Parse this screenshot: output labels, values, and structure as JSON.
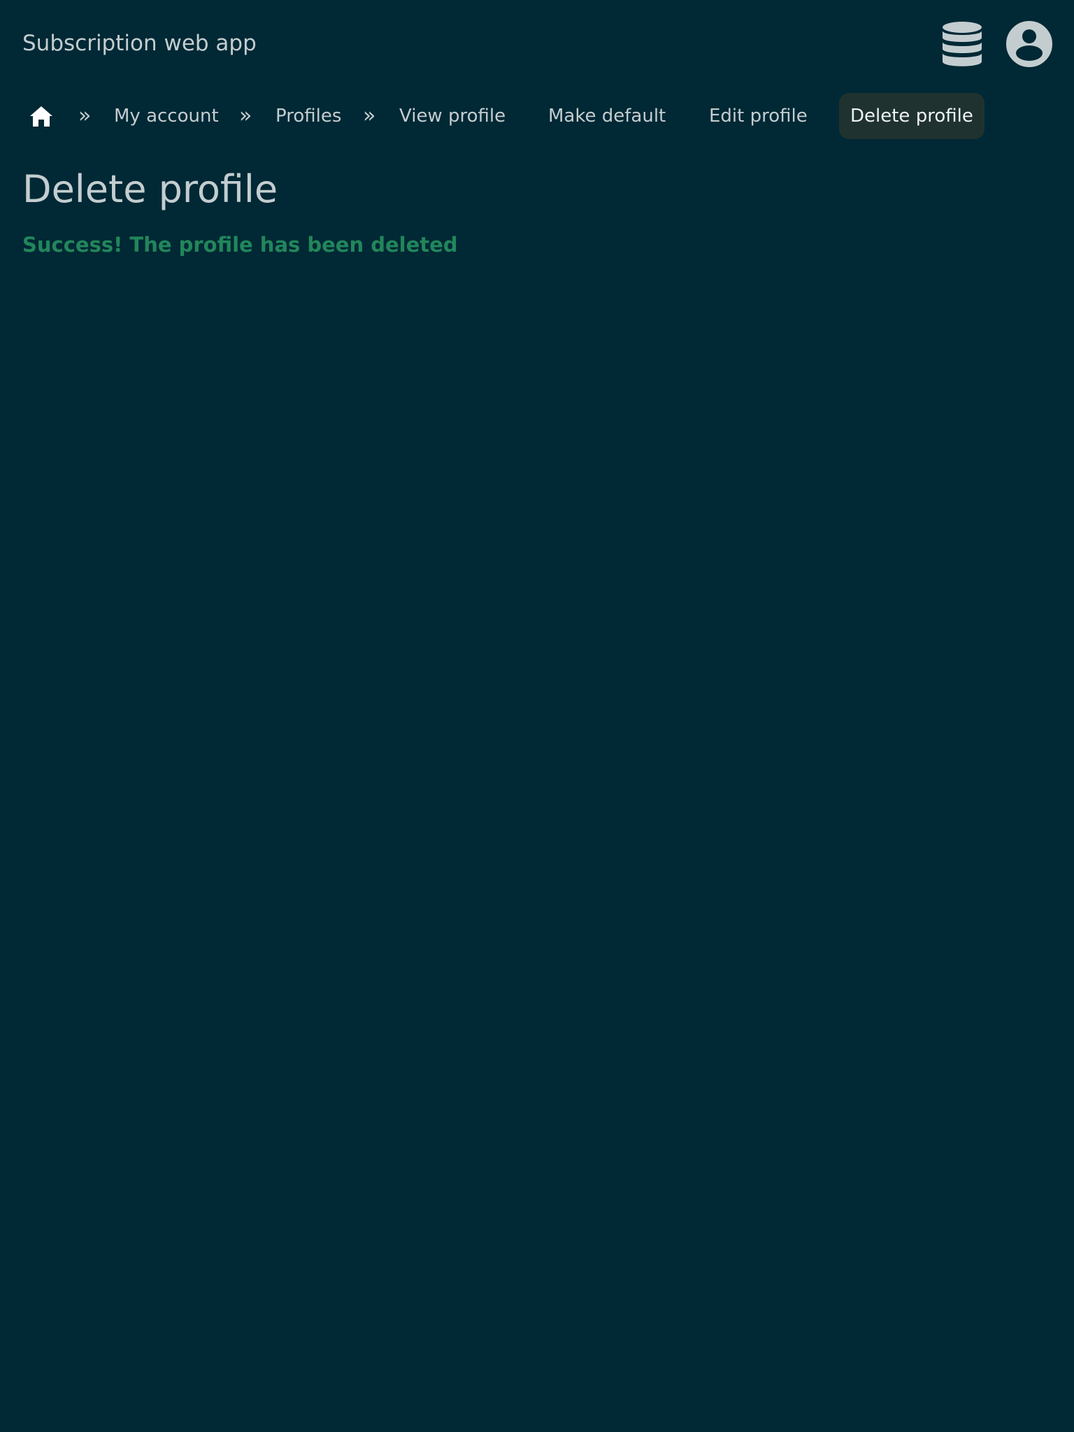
{
  "header": {
    "app_title": "Subscription web app",
    "icons": [
      "database-icon",
      "user-circle-icon"
    ]
  },
  "breadcrumb": {
    "home_icon": "home-icon",
    "separator": "»",
    "items": [
      {
        "label": "My account"
      },
      {
        "label": "Profiles"
      },
      {
        "label": "View profile"
      }
    ]
  },
  "actions": {
    "items": [
      {
        "label": "Make default"
      },
      {
        "label": "Edit profile"
      },
      {
        "label": "Delete profile",
        "active": true
      }
    ]
  },
  "main": {
    "title": "Delete profile",
    "message": "Success! The profile has been deleted"
  },
  "colors": {
    "background": "#002835",
    "text": "#c3cdcf",
    "success": "#22865b",
    "active_tab_bg": "#1f3230"
  }
}
